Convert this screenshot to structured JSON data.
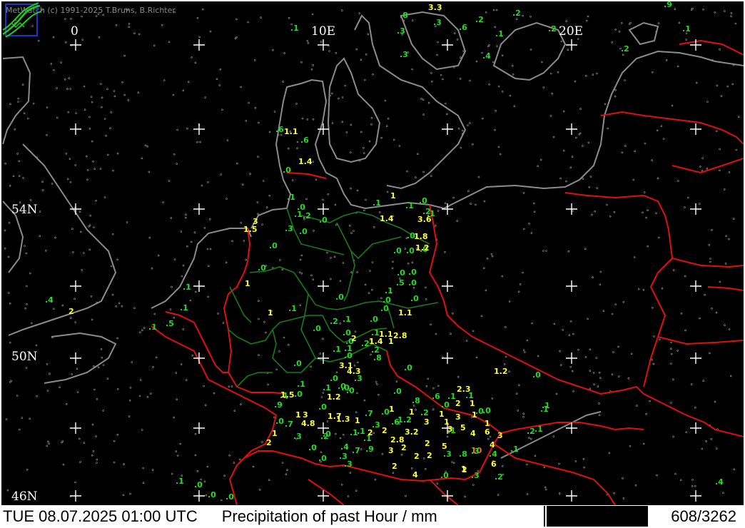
{
  "copyright": "MetWatch  (c) 1991-2025 T.Bruns, B.Richter",
  "footer": {
    "datetime": "TUE 08.07.2025 01:00 UTC",
    "title": "Precipitation of past  Hour  / mm",
    "count": "608/3262"
  },
  "grid_labels": {
    "lon": [
      "0",
      "10E",
      "20E"
    ],
    "lat": [
      "54N",
      "50N",
      "46N"
    ]
  },
  "colors": {
    "background": "#000000",
    "coast": "#8c8c8c",
    "border": "#e01010",
    "state_border": "#1a7a1a",
    "low_value": "#22dd22",
    "mid_value": "#ffff33",
    "high_value": "#ff7722"
  },
  "observations": [
    {
      "v": "3.3"
    },
    {
      "v": ".2"
    },
    {
      "v": ".8"
    },
    {
      "v": ".1"
    },
    {
      "v": ".3"
    },
    {
      "v": ".3"
    },
    {
      "v": ".6"
    },
    {
      "v": ".2"
    },
    {
      "v": ".1"
    },
    {
      "v": ".2"
    },
    {
      "v": ".1"
    },
    {
      "v": ".2"
    },
    {
      "v": ".3"
    },
    {
      "v": ".4"
    },
    {
      "v": ".9"
    },
    {
      "v": ".6"
    },
    {
      "v": "1.1"
    },
    {
      "v": ".6"
    },
    {
      "v": "1.4"
    },
    {
      "v": ".0"
    },
    {
      "v": ".1"
    },
    {
      "v": ".1"
    },
    {
      "v": ".0"
    },
    {
      "v": ".1"
    },
    {
      "v": "1"
    },
    {
      "v": ".0"
    },
    {
      "v": ".1"
    },
    {
      "v": ".2"
    },
    {
      "v": ".0"
    },
    {
      "v": "3"
    },
    {
      "v": "1.5"
    },
    {
      "v": ".3"
    },
    {
      "v": ".0"
    },
    {
      "v": "1.4"
    },
    {
      "v": "3.6"
    },
    {
      "v": ".2"
    },
    {
      "v": ".1"
    },
    {
      "v": ".0"
    },
    {
      "v": "1.8"
    },
    {
      "v": ".0"
    },
    {
      "v": "1.2"
    },
    {
      "v": ".0"
    },
    {
      "v": ".0"
    },
    {
      "v": ".0"
    },
    {
      "v": ".0"
    },
    {
      "v": "1"
    },
    {
      "v": ".0"
    },
    {
      "v": ".0"
    },
    {
      "v": ".5"
    },
    {
      "v": ".0"
    },
    {
      "v": ".1"
    },
    {
      "v": ".0"
    },
    {
      "v": ".0"
    },
    {
      "v": "1.1"
    },
    {
      "v": ".0"
    },
    {
      "v": ".1"
    },
    {
      "v": ".4"
    },
    {
      "v": "2"
    },
    {
      "v": ".1"
    },
    {
      "v": ".1"
    },
    {
      "v": ".5"
    },
    {
      "v": "1"
    },
    {
      "v": ".1"
    },
    {
      "v": ".0"
    },
    {
      "v": ".0"
    },
    {
      "v": ".2"
    },
    {
      "v": ".1"
    },
    {
      "v": ".0"
    },
    {
      "v": ".0"
    },
    {
      "v": ".1"
    },
    {
      "v": "1.1"
    },
    {
      "v": "2.8"
    },
    {
      "v": ".0"
    },
    {
      "v": "1.4"
    },
    {
      "v": "1"
    },
    {
      "v": ".2"
    },
    {
      "v": "2"
    },
    {
      "v": ".1"
    },
    {
      "v": ".1"
    },
    {
      "v": ".2"
    },
    {
      "v": ".8"
    },
    {
      "v": ".0"
    },
    {
      "v": "3.1"
    },
    {
      "v": "4.3"
    },
    {
      "v": ".0"
    },
    {
      "v": "1.2"
    },
    {
      "v": ".0"
    },
    {
      "v": ".0"
    },
    {
      "v": ".0"
    },
    {
      "v": ".3"
    },
    {
      "v": ".1"
    },
    {
      "v": ".1"
    },
    {
      "v": ".0"
    },
    {
      "v": ".0"
    },
    {
      "v": "1.5"
    },
    {
      "v": ".0"
    },
    {
      "v": ".1"
    },
    {
      "v": ".0"
    },
    {
      "v": ".0"
    },
    {
      "v": "2.3"
    },
    {
      "v": ".6"
    },
    {
      "v": ".1"
    },
    {
      "v": ".1"
    },
    {
      "v": ".8"
    },
    {
      "v": ".9"
    },
    {
      "v": "1.2"
    },
    {
      "v": ".0"
    },
    {
      "v": "3"
    },
    {
      "v": "1"
    },
    {
      "v": "1"
    },
    {
      "v": ".2"
    },
    {
      "v": ".0"
    },
    {
      "v": "1"
    },
    {
      "v": "2"
    },
    {
      "v": "1"
    },
    {
      "v": ".0"
    },
    {
      "v": ".0"
    },
    {
      "v": ".1"
    },
    {
      "v": ".0"
    },
    {
      "v": ".7"
    },
    {
      "v": "4.8"
    },
    {
      "v": "1.7"
    },
    {
      "v": "1.3"
    },
    {
      "v": "1"
    },
    {
      "v": ".0"
    },
    {
      "v": "1"
    },
    {
      "v": ".3"
    },
    {
      "v": ".7"
    },
    {
      "v": ".1"
    },
    {
      "v": ".6"
    },
    {
      "v": ".1"
    },
    {
      "v": ".2"
    },
    {
      "v": "3"
    },
    {
      "v": "1"
    },
    {
      "v": "3"
    },
    {
      "v": "1"
    },
    {
      "v": "1"
    },
    {
      "v": ".2"
    },
    {
      "v": "1"
    },
    {
      "v": ".3"
    },
    {
      "v": ".2"
    },
    {
      "v": ".0"
    },
    {
      "v": ".1"
    },
    {
      "v": ".4"
    },
    {
      "v": "2"
    },
    {
      "v": "2"
    },
    {
      "v": "3.2"
    },
    {
      "v": "3"
    },
    {
      "v": ".1"
    },
    {
      "v": "5"
    },
    {
      "v": "4"
    },
    {
      "v": "6"
    },
    {
      "v": "3"
    },
    {
      "v": "2"
    },
    {
      "v": ".1"
    },
    {
      "v": "2.8"
    },
    {
      "v": "2"
    },
    {
      "v": "5"
    },
    {
      "v": "4"
    },
    {
      "v": "10"
    },
    {
      "v": ".1"
    },
    {
      "v": ".0"
    },
    {
      "v": ".0"
    },
    {
      "v": ".3"
    },
    {
      "v": ".7"
    },
    {
      "v": ".9"
    },
    {
      "v": "3"
    },
    {
      "v": "2"
    },
    {
      "v": "2"
    },
    {
      "v": "2"
    },
    {
      "v": ".3"
    },
    {
      "v": ".8"
    },
    {
      "v": ".3"
    },
    {
      "v": ".4"
    },
    {
      "v": "1"
    },
    {
      "v": "6"
    },
    {
      "v": ".3"
    },
    {
      "v": "2"
    },
    {
      "v": "4"
    },
    {
      "v": ".0"
    },
    {
      "v": "2"
    },
    {
      "v": ".3"
    },
    {
      "v": ".2"
    },
    {
      "v": ".1"
    },
    {
      "v": ".0"
    },
    {
      "v": ".0"
    },
    {
      "v": ".0"
    },
    {
      "v": ".4"
    },
    {
      "v": ".1"
    },
    {
      "v": ".1"
    },
    {
      "v": ".0"
    }
  ]
}
